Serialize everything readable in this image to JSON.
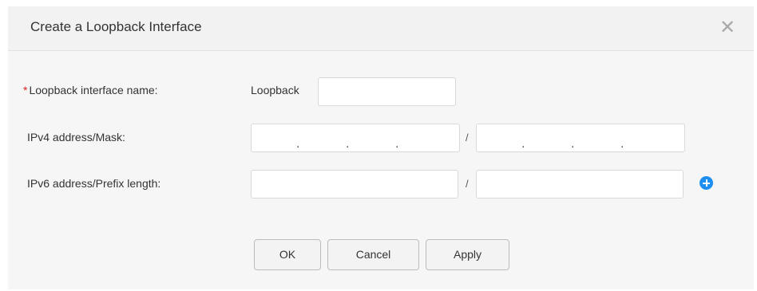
{
  "dialog": {
    "title": "Create a Loopback Interface",
    "close_icon": "close-icon",
    "close_glyph": "✕"
  },
  "form": {
    "required_marker": "*",
    "loopback": {
      "label": "Loopback interface name:",
      "prefix": "Loopback",
      "value": ""
    },
    "ipv4": {
      "label": "IPv4 address/Mask:",
      "separator": "/",
      "dot": ".",
      "address_value": "",
      "mask_value": ""
    },
    "ipv6": {
      "label": "IPv6 address/Prefix length:",
      "separator": "/",
      "address_value": "",
      "prefix_value": "",
      "add_icon": "plus-circle-icon"
    }
  },
  "buttons": {
    "ok": "OK",
    "cancel": "Cancel",
    "apply": "Apply"
  },
  "colors": {
    "accent": "#1e8ff0",
    "required": "#e02020"
  }
}
